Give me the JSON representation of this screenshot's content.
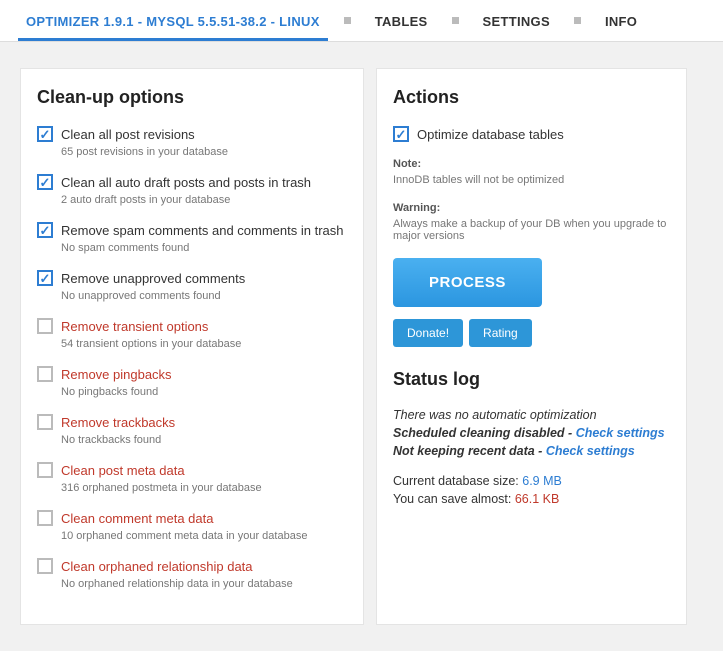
{
  "tabs": {
    "brand": "OPTIMIZER 1.9.1 - MYSQL 5.5.51-38.2 - LINUX",
    "tables": "TABLES",
    "settings": "SETTINGS",
    "info": "INFO"
  },
  "cleanup": {
    "heading": "Clean-up options",
    "items": [
      {
        "label": "Clean all post revisions",
        "sub": "65 post revisions in your database",
        "checked": true,
        "danger": false
      },
      {
        "label": "Clean all auto draft posts and posts in trash",
        "sub": "2 auto draft posts in your database",
        "checked": true,
        "danger": false
      },
      {
        "label": "Remove spam comments and comments in trash",
        "sub": "No spam comments found",
        "checked": true,
        "danger": false
      },
      {
        "label": "Remove unapproved comments",
        "sub": "No unapproved comments found",
        "checked": true,
        "danger": false
      },
      {
        "label": "Remove transient options",
        "sub": "54 transient options in your database",
        "checked": false,
        "danger": true
      },
      {
        "label": "Remove pingbacks",
        "sub": "No pingbacks found",
        "checked": false,
        "danger": true
      },
      {
        "label": "Remove trackbacks",
        "sub": "No trackbacks found",
        "checked": false,
        "danger": true
      },
      {
        "label": "Clean post meta data",
        "sub": "316 orphaned postmeta in your database",
        "checked": false,
        "danger": true
      },
      {
        "label": "Clean comment meta data",
        "sub": "10 orphaned comment meta data in your database",
        "checked": false,
        "danger": true
      },
      {
        "label": "Clean orphaned relationship data",
        "sub": "No orphaned relationship data in your database",
        "checked": false,
        "danger": true
      }
    ]
  },
  "actions": {
    "heading": "Actions",
    "optimize": {
      "label": "Optimize database tables",
      "checked": true
    },
    "noteLabel": "Note:",
    "noteText": "InnoDB tables will not be optimized",
    "warningLabel": "Warning:",
    "warningText": "Always make a backup of your DB when you upgrade to major versions",
    "process": "PROCESS",
    "donate": "Donate!",
    "rating": "Rating"
  },
  "status": {
    "heading": "Status log",
    "line1": "There was no automatic optimization",
    "line2a": "Scheduled cleaning disabled - ",
    "line2link": "Check settings",
    "line3a": "Not keeping recent data - ",
    "line3link": "Check settings",
    "dbSizeLabel": "Current database size: ",
    "dbSize": "6.9 MB",
    "saveLabel": "You can save almost: ",
    "save": "66.1 KB"
  }
}
